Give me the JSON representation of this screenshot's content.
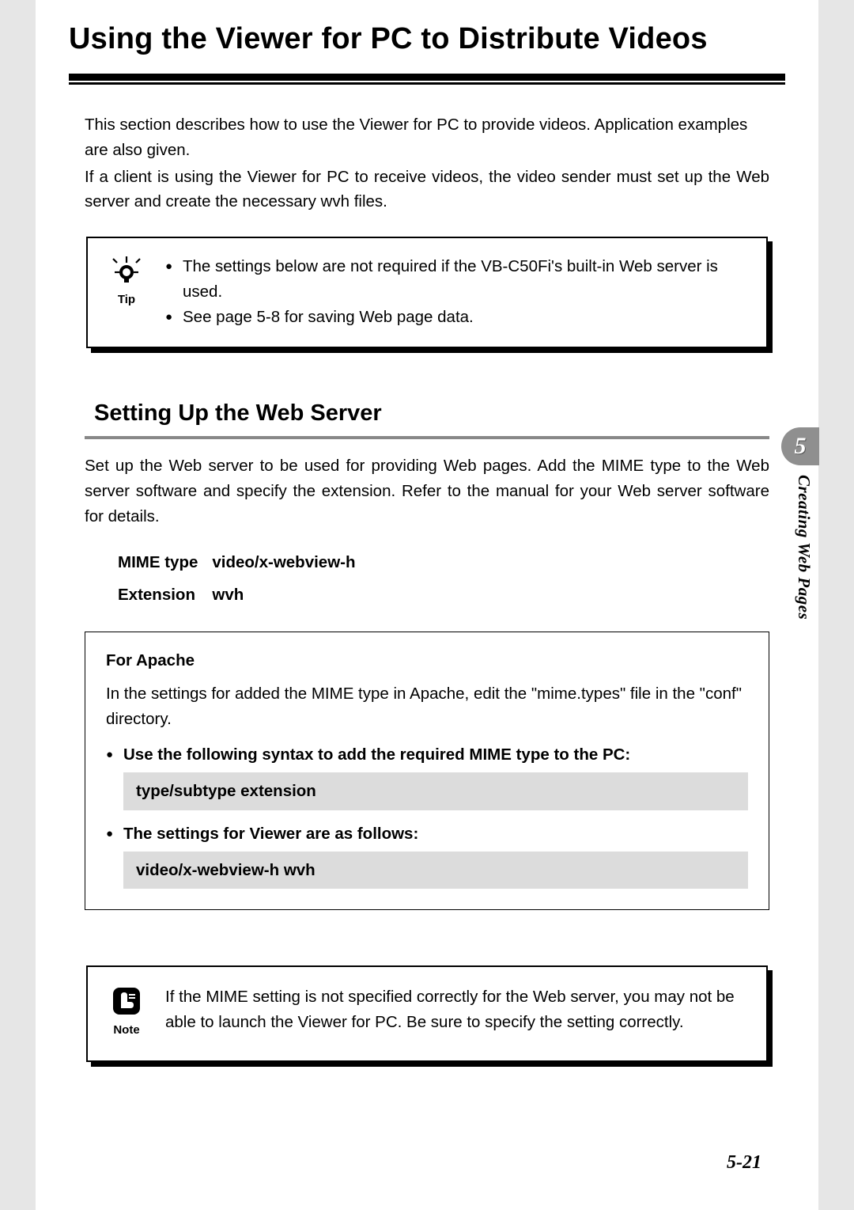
{
  "title": "Using the Viewer for PC to Distribute Videos",
  "intro": {
    "p1": "This section describes how to use the Viewer for PC to provide videos. Application examples are also given.",
    "p2": "If a client is using the Viewer for PC to receive videos, the video sender must set up the Web server and create the necessary wvh files."
  },
  "tip": {
    "label": "Tip",
    "bullets": [
      "The settings below are not required if the VB-C50Fi's built-in Web server is used.",
      "See page 5-8 for saving Web page data."
    ]
  },
  "section": {
    "heading": "Setting Up the Web Server",
    "body": "Set up the Web server to be used for providing Web pages. Add the MIME type to the Web server software and specify the extension. Refer to the manual for your Web server software for details."
  },
  "mime": {
    "row1_label": "MIME type",
    "row1_value": "video/x-webview-h",
    "row2_label": "Extension",
    "row2_value": "wvh"
  },
  "apache": {
    "title": "For Apache",
    "body": "In the settings for added the MIME type in Apache, edit the \"mime.types\" file in the \"conf\" directory.",
    "bullet1": "Use the following syntax to add the required MIME type to the PC:",
    "code1": "type/subtype extension",
    "bullet2": "The settings for Viewer are as follows:",
    "code2": "video/x-webview-h wvh"
  },
  "note": {
    "label": "Note",
    "body": "If the MIME setting is not specified correctly for the Web server, you may not be able to launch the Viewer for PC. Be sure to specify the setting correctly."
  },
  "side": {
    "chapter_number": "5",
    "chapter_title": "Creating Web Pages"
  },
  "page_number": "5-21"
}
